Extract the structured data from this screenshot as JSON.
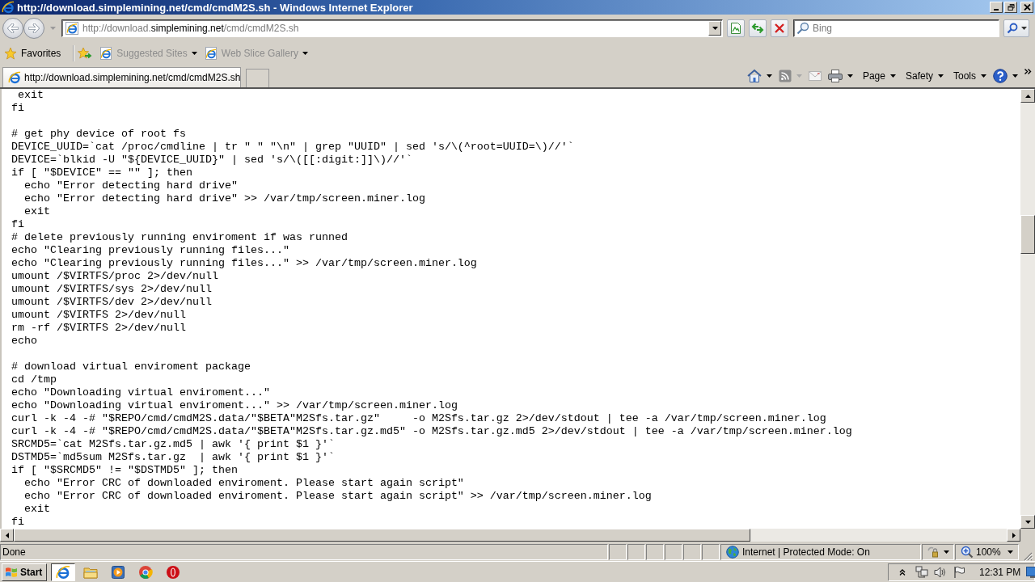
{
  "window": {
    "title": "http://download.simplemining.net/cmd/cmdM2S.sh - Windows Internet Explorer"
  },
  "address_bar": {
    "url_parts": [
      {
        "text": "http://download.",
        "highlighted": false
      },
      {
        "text": "simplemining.net",
        "highlighted": true
      },
      {
        "text": "/cmd/cmdM2S.sh",
        "highlighted": false
      }
    ]
  },
  "search": {
    "placeholder": "Bing"
  },
  "favorites_bar": {
    "label": "Favorites",
    "links": [
      {
        "label": "Suggested Sites",
        "disabled": true
      },
      {
        "label": "Web Slice Gallery",
        "disabled": true
      }
    ]
  },
  "tabs": [
    {
      "label": "http://download.simplemining.net/cmd/cmdM2S.sh",
      "selected": true
    }
  ],
  "command_bar": {
    "menus": [
      {
        "label": "Page"
      },
      {
        "label": "Safety"
      },
      {
        "label": "Tools"
      }
    ]
  },
  "document": {
    "blocks": [
      [
        " exit",
        "fi"
      ],
      [
        "# get phy device of root fs",
        "DEVICE_UUID=`cat /proc/cmdline | tr \" \" \"\\n\" | grep \"UUID\" | sed 's/\\(^root=UUID=\\)//'`",
        "DEVICE=`blkid -U \"${DEVICE_UUID}\" | sed 's/\\([[:digit:]]\\)//'`",
        "if [ \"$DEVICE\" == \"\" ]; then",
        "  echo \"Error detecting hard drive\"",
        "  echo \"Error detecting hard drive\" >> /var/tmp/screen.miner.log",
        "  exit",
        "fi",
        "# delete previously running enviroment if was runned",
        "echo \"Clearing previously running files...\"",
        "echo \"Clearing previously running files...\" >> /var/tmp/screen.miner.log",
        "umount /$VIRTFS/proc 2>/dev/null",
        "umount /$VIRTFS/sys 2>/dev/null",
        "umount /$VIRTFS/dev 2>/dev/null",
        "umount /$VIRTFS 2>/dev/null",
        "rm -rf /$VIRTFS 2>/dev/null",
        "echo"
      ],
      [
        "# download virtual enviroment package",
        "cd /tmp",
        "echo \"Downloading virtual enviroment...\"",
        "echo \"Downloading virtual enviroment...\" >> /var/tmp/screen.miner.log",
        "curl -k -4 -# \"$REPO/cmd/cmdM2S.data/\"$BETA\"M2Sfs.tar.gz\"     -o M2Sfs.tar.gz 2>/dev/stdout | tee -a /var/tmp/screen.miner.log",
        "curl -k -4 -# \"$REPO/cmd/cmdM2S.data/\"$BETA\"M2Sfs.tar.gz.md5\" -o M2Sfs.tar.gz.md5 2>/dev/stdout | tee -a /var/tmp/screen.miner.log",
        "SRCMD5=`cat M2Sfs.tar.gz.md5 | awk '{ print $1 }'`",
        "DSTMD5=`md5sum M2Sfs.tar.gz  | awk '{ print $1 }'`",
        "if [ \"$SRCMD5\" != \"$DSTMD5\" ]; then",
        "  echo \"Error CRC of downloaded enviroment. Please start again script\"",
        "  echo \"Error CRC of downloaded enviroment. Please start again script\" >> /var/tmp/screen.miner.log",
        "  exit",
        "fi"
      ]
    ]
  },
  "status_bar": {
    "text": "Done",
    "zone": "Internet | Protected Mode: On",
    "zoom": "100%"
  },
  "taskbar": {
    "start": "Start",
    "apps": [
      {
        "selected": true
      },
      {
        "selected": false
      },
      {
        "selected": false
      },
      {
        "selected": false
      },
      {
        "selected": false
      }
    ],
    "clock": "12:31 PM"
  }
}
